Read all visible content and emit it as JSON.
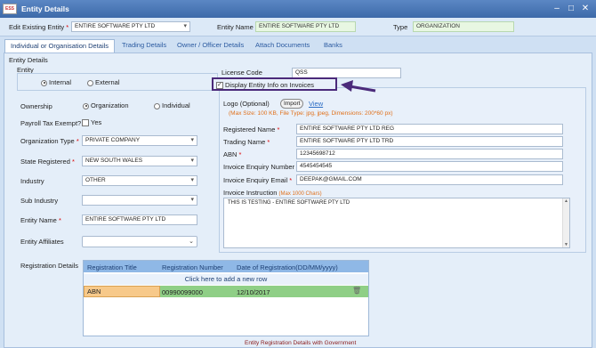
{
  "window": {
    "title": "Entity Details",
    "logo_text": "ESS",
    "controls": [
      "–",
      "□",
      "✕"
    ]
  },
  "top_bar": {
    "edit_existing_label": "Edit Existing Entity",
    "edit_existing_value": "ENTIRE SOFTWARE PTY LTD",
    "entity_name_label": "Entity Name",
    "entity_name_value": "ENTIRE SOFTWARE PTY LTD",
    "type_label": "Type",
    "type_value": "ORGANIZATION"
  },
  "tabs": [
    {
      "label": "Individual or Organisation Details",
      "active": true
    },
    {
      "label": "Trading Details"
    },
    {
      "label": "Owner / Officer Details"
    },
    {
      "label": "Attach Documents"
    },
    {
      "label": "Banks"
    }
  ],
  "section_title": "Entity Details",
  "entity_group": {
    "title": "Entity",
    "internal": "Internal",
    "external": "External",
    "selected": "Internal"
  },
  "left_form": {
    "ownership_label": "Ownership",
    "ownership_org": "Organization",
    "ownership_ind": "Individual",
    "payroll_label": "Payroll Tax Exempt?",
    "payroll_yes": "Yes",
    "org_type_label": "Organization Type",
    "org_type_value": "PRIVATE COMPANY",
    "state_label": "State Registered",
    "state_value": "NEW SOUTH WALES",
    "industry_label": "Industry",
    "industry_value": "OTHER",
    "sub_industry_label": "Sub Industry",
    "sub_industry_value": "",
    "entity_name_label": "Entity Name",
    "entity_name_value": "ENTIRE SOFTWARE PTY LTD",
    "affiliates_label": "Entity Affiliates",
    "affiliates_value": ""
  },
  "right_form": {
    "license_label": "License Code",
    "license_value": "QSS",
    "display_info_label": "Display Entity Info on Invoices",
    "display_info_checked": true,
    "logo_label": "Logo (Optional)",
    "import_label": "Import",
    "view_label": "View",
    "logo_hint": "(Max Size: 100 KB, File Type: jpg, jpeg, Dimensions: 200*60 px)",
    "registered_name_label": "Registered Name",
    "registered_name_value": "ENTIRE SOFTWARE PTY LTD REG",
    "trading_name_label": "Trading Name",
    "trading_name_value": "ENTIRE SOFTWARE PTY LTD TRD",
    "abn_label": "ABN",
    "abn_value": "12345698712",
    "enquiry_number_label": "Invoice Enquiry Number",
    "enquiry_number_value": "4545454545",
    "enquiry_email_label": "Invoice Enquiry Email",
    "enquiry_email_value": "DEEPAK@GMAIL.COM",
    "instruction_label": "Invoice Instruction",
    "instruction_hint": "(Max 1000 Chars)",
    "instruction_value": "THIS IS TESTING - ENTIRE SOFTWARE PTY LTD"
  },
  "registration": {
    "label": "Registration Details",
    "columns": [
      "Registration Title",
      "Registration Number",
      "Date of Registration(DD/MM/yyyy)"
    ],
    "add_row_text": "Click here to add a new row",
    "rows": [
      {
        "title": "ABN",
        "number": "00990099000",
        "date": "12/10/2017"
      }
    ],
    "footer": "Entity Registration Details with Government"
  },
  "colors": {
    "accent": "#3d6aa9",
    "highlight_box": "#4b2a7a",
    "row_green": "#8fcf86",
    "row_orange": "#f7c98a"
  }
}
